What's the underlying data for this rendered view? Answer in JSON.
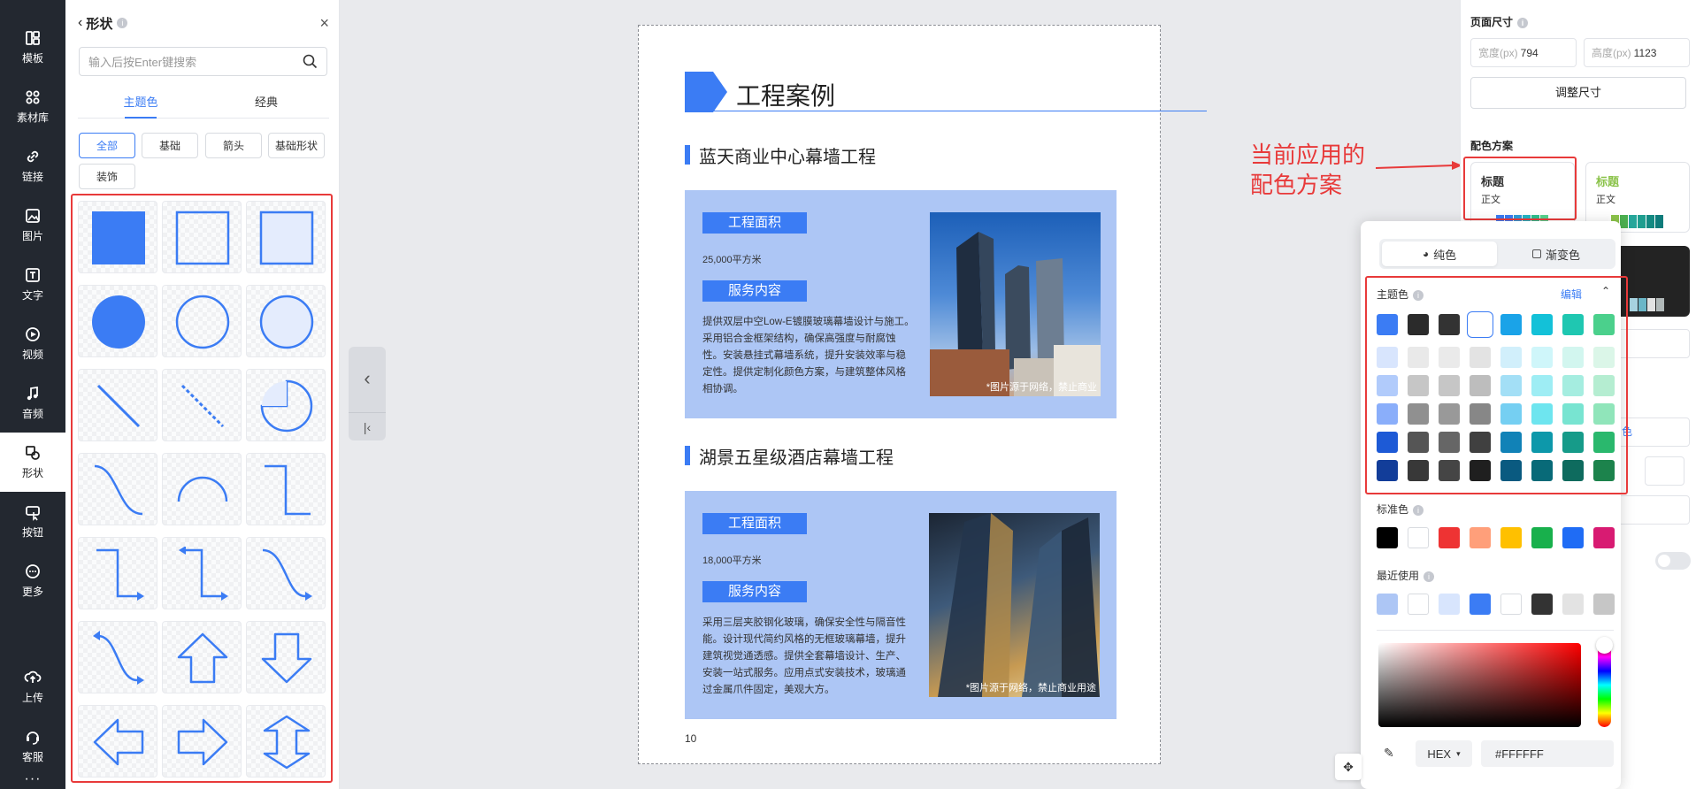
{
  "nav": {
    "items": [
      {
        "label": "模板",
        "icon": "template-icon"
      },
      {
        "label": "素材库",
        "icon": "material-library-icon"
      },
      {
        "label": "链接",
        "icon": "link-icon"
      },
      {
        "label": "图片",
        "icon": "image-icon"
      },
      {
        "label": "文字",
        "icon": "text-icon"
      },
      {
        "label": "视频",
        "icon": "video-icon"
      },
      {
        "label": "音频",
        "icon": "audio-icon"
      },
      {
        "label": "形状",
        "icon": "shape-icon",
        "active": true
      },
      {
        "label": "按钮",
        "icon": "button-icon"
      },
      {
        "label": "更多",
        "icon": "more-icon"
      },
      {
        "label": "上传",
        "icon": "upload-icon"
      },
      {
        "label": "客服",
        "icon": "customer-service-icon"
      }
    ],
    "more_dots": "···"
  },
  "shape_panel": {
    "title": "形状",
    "search_placeholder": "输入后按Enter键搜索",
    "tabs": [
      {
        "label": "主题色",
        "active": true
      },
      {
        "label": "经典",
        "active": false
      }
    ],
    "filters": [
      {
        "label": "全部",
        "active": true
      },
      {
        "label": "基础"
      },
      {
        "label": "箭头"
      },
      {
        "label": "基础形状"
      },
      {
        "label": "装饰"
      }
    ],
    "shapes": [
      "filled-square",
      "outline-square",
      "light-square",
      "filled-circle",
      "outline-circle",
      "light-circle",
      "diagonal-line",
      "dashed-diagonal-line",
      "pie-shape",
      "s-curve",
      "arc",
      "elbow-connector",
      "elbow-arrow",
      "double-elbow-arrow",
      "curved-arrow",
      "curved-double-arrow",
      "up-arrow",
      "down-arrow",
      "left-arrow",
      "right-arrow",
      "up-down-arrow"
    ]
  },
  "collapse": {
    "prev": "‹",
    "first": "|‹"
  },
  "document": {
    "title": "工程案例",
    "page_number": "10",
    "sections": [
      {
        "title": "蓝天商业中心幕墙工程",
        "area_label": "工程面积",
        "area_value": "25,000平方米",
        "service_label": "服务内容",
        "service_text": "提供双层中空Low-E镀膜玻璃幕墙设计与施工。采用铝合金框架结构，确保高强度与耐腐蚀性。安装悬挂式幕墙系统，提升安装效率与稳定性。提供定制化颜色方案，与建筑整体风格相协调。",
        "photo_caption": "*图片源于网络，禁止商业"
      },
      {
        "title": "湖景五星级酒店幕墙工程",
        "area_label": "工程面积",
        "area_value": "18,000平方米",
        "service_label": "服务内容",
        "service_text": "采用三层夹胶钢化玻璃，确保安全性与隔音性能。设计现代简约风格的无框玻璃幕墙，提升建筑视觉通透感。提供全套幕墙设计、生产、安装一站式服务。应用点式安装技术，玻璃通过金属爪件固定，美观大方。",
        "photo_caption": "*图片源于网络，禁止商业用途"
      }
    ]
  },
  "annotation": {
    "line1": "当前应用的",
    "line2": "配色方案"
  },
  "right_panel": {
    "page_size_label": "页面尺寸",
    "width_label": "宽度(px)",
    "width_value": "794",
    "height_label": "高度(px)",
    "height_value": "1123",
    "resize_button": "调整尺寸",
    "color_scheme_label": "配色方案",
    "schemes": [
      {
        "title": "标题",
        "body": "正文",
        "title_color": "#222222",
        "colors": [
          "#3b7cf4",
          "#3b7cf4",
          "#2d9cdb",
          "#23b5c4",
          "#2fbf8f",
          "#57d38f"
        ]
      },
      {
        "title": "标题",
        "body": "正文",
        "title_color": "#8bc34a",
        "colors": [
          "#8bc34a",
          "#4caf50",
          "#26a69a",
          "#1e9e8f",
          "#138a82",
          "#0e7c7b"
        ]
      }
    ],
    "dark_scheme_colors": [
      "#a7d3e0",
      "#6bb6c7",
      "#e2e2e2",
      "#b0b8b8"
    ],
    "partial_label": "色"
  },
  "color_popup": {
    "solid_label": "纯色",
    "gradient_label": "渐变色",
    "theme_label": "主题色",
    "edit_label": "编辑",
    "theme_colors": [
      [
        "#3b7cf4",
        "#2b2b2b",
        "#333333",
        "#ffffff",
        "#1aa3e8",
        "#13c1d8",
        "#1fc7b1",
        "#4bd08c"
      ],
      [
        "#d8e5fd",
        "#e9e9e9",
        "#eaeaea",
        "#e3e3e3",
        "#d1effb",
        "#cff6fa",
        "#d2f6ef",
        "#dbf6e8"
      ],
      [
        "#b1cbfb",
        "#c6c6c6",
        "#c6c6c6",
        "#bdbdbd",
        "#a3dff6",
        "#9eedf4",
        "#a5ede0",
        "#b5edd1"
      ],
      [
        "#8aaefa",
        "#909090",
        "#999999",
        "#878787",
        "#75cff2",
        "#6ee5ef",
        "#78e4d1",
        "#90e5ba"
      ],
      [
        "#1d5ad6",
        "#555555",
        "#666666",
        "#404040",
        "#1182b7",
        "#0d98aa",
        "#169b89",
        "#2ab86d"
      ],
      [
        "#123d99",
        "#383838",
        "#454545",
        "#1f1f1f",
        "#0a5a80",
        "#086a78",
        "#0e6b5e",
        "#1c834c"
      ]
    ],
    "selected_index": [
      0,
      3
    ],
    "standard_label": "标准色",
    "standard_colors": [
      "#000000",
      "#ffffff",
      "#ee3333",
      "#ff9f7a",
      "#ffc000",
      "#18b04c",
      "#1f6cf5",
      "#d81b72"
    ],
    "recent_label": "最近使用",
    "recent_colors": [
      "#adc6f5",
      "#ffffff",
      "#d8e5fd",
      "#3b7cf4",
      "#ffffff",
      "#333333",
      "#e3e3e3",
      "#c6c6c6"
    ],
    "mode": "HEX",
    "hex_value": "#FFFFFF"
  },
  "colors": {
    "accent": "#3b7cf4",
    "annotation": "#e83a3a",
    "card_bg": "#adc6f5"
  }
}
